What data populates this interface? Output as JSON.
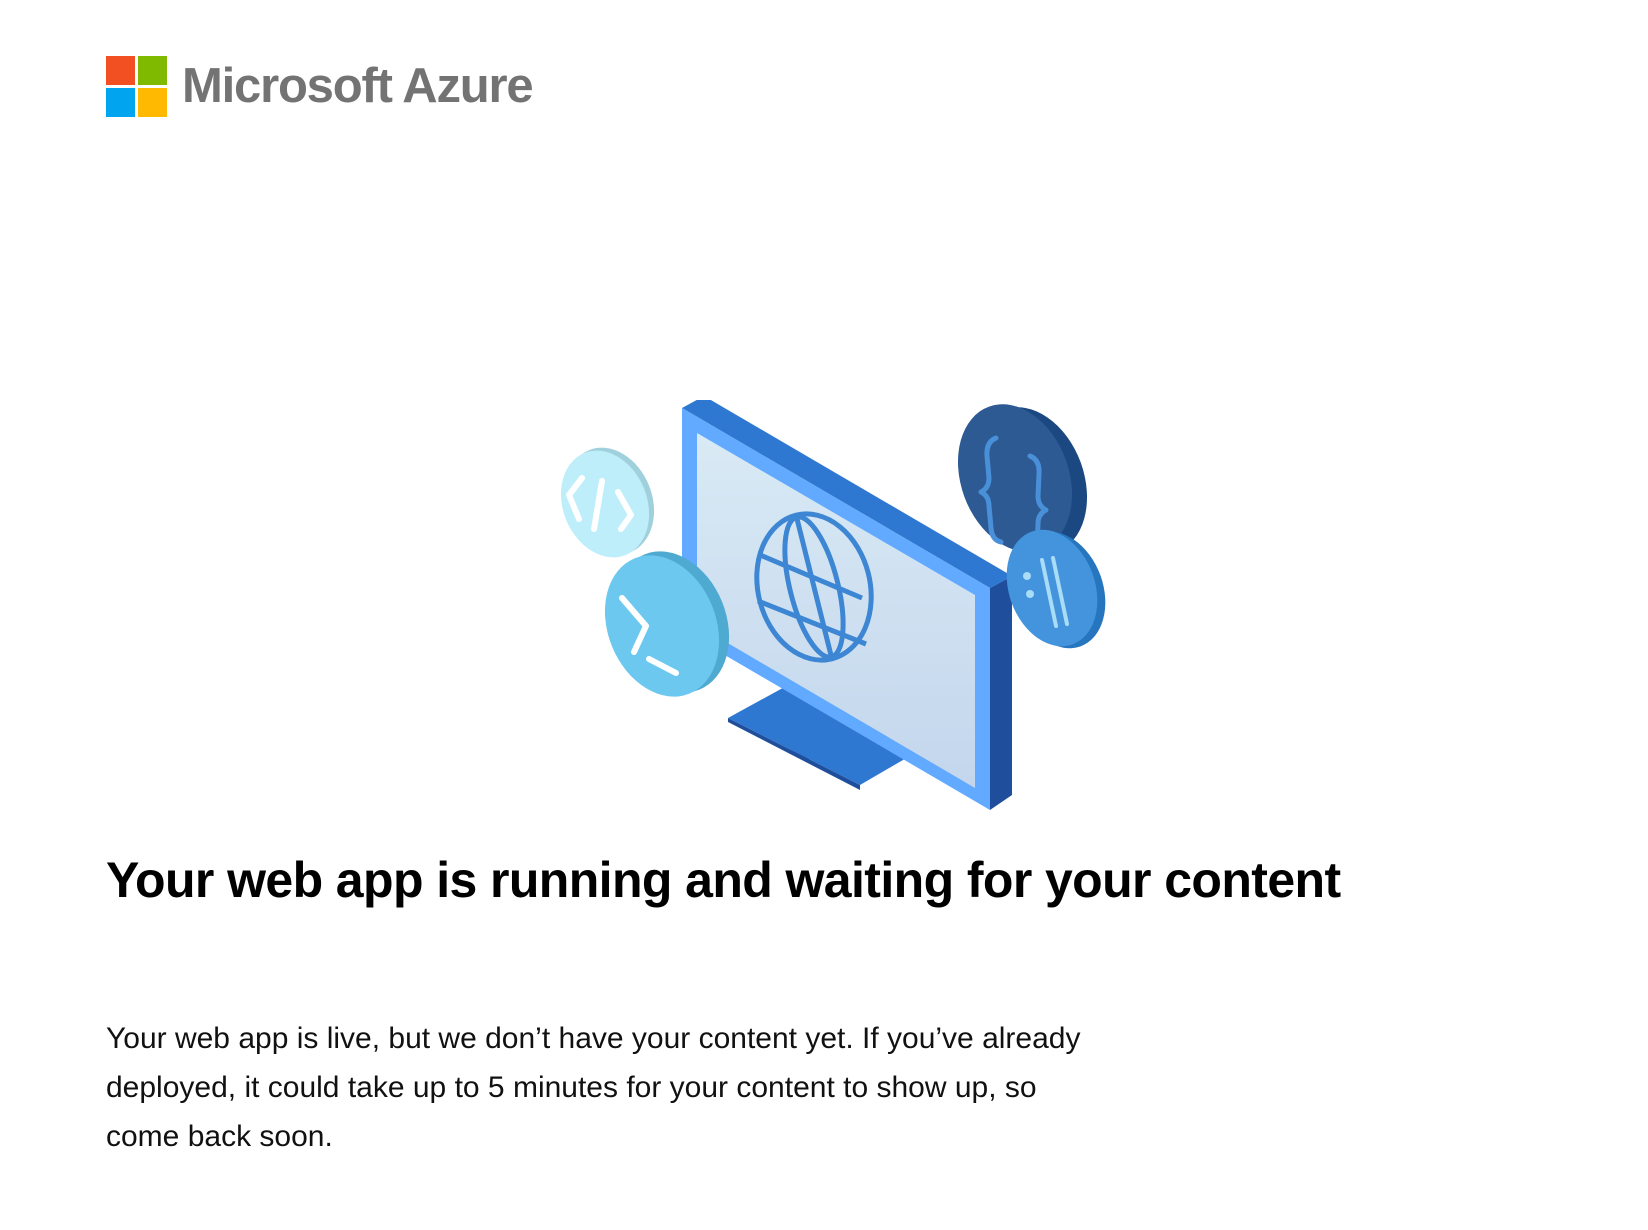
{
  "brand": {
    "name": "Microsoft Azure",
    "logo_colors": {
      "red": "#f25022",
      "green": "#7fba00",
      "blue": "#00a4ef",
      "yellow": "#ffb900"
    }
  },
  "illustration": {
    "icons": [
      "code-tag-icon",
      "terminal-prompt-icon",
      "globe-icon",
      "curly-braces-icon",
      "url-scheme-icon"
    ],
    "colors": {
      "monitor_frame": "#2f78d2",
      "monitor_side": "#1f4f9c",
      "screen_top": "#d9eaf5",
      "screen_bottom": "#c3d6ec",
      "globe": "#3d86d3",
      "code_coin": "#bfeefb",
      "terminal_coin": "#6dc8ef",
      "braces_coin": "#2d5a92",
      "url_coin": "#4393dd"
    }
  },
  "main": {
    "headline": "Your web app is running and waiting for your content",
    "body": "Your web app is live, but we don’t have your content yet. If you’ve already deployed, it could take up to 5 minutes for your content to show up, so come back soon."
  }
}
